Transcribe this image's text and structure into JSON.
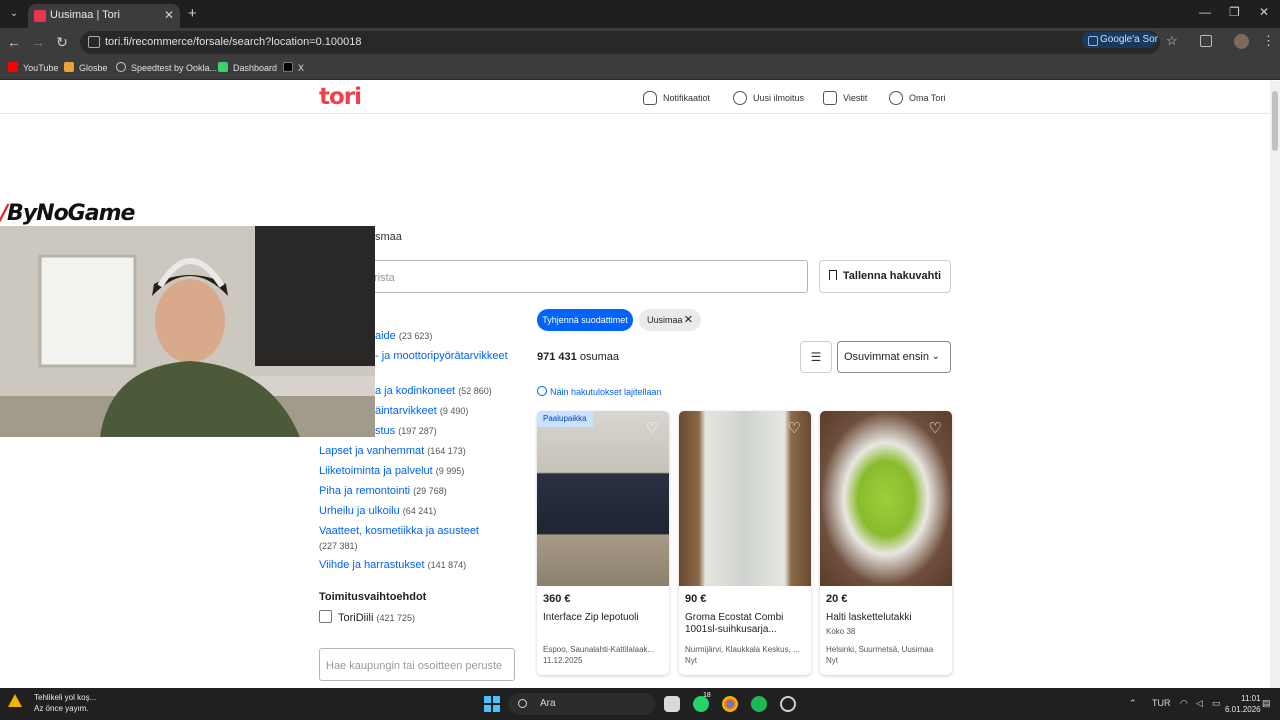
{
  "browser": {
    "tab_title": "Uusimaa | Tori",
    "url": "tori.fi/recommerce/forsale/search?location=0.100018",
    "google_button": "Google'a Sor",
    "bookmarks": [
      "YouTube",
      "Glosbe",
      "Speedtest by Ookla...",
      "Dashboard",
      "X"
    ]
  },
  "header": {
    "logo": "tori",
    "nav": [
      "Notifikaatiot",
      "Uusi ilmoitus",
      "Viestit",
      "Oma Tori"
    ]
  },
  "overlay": {
    "brand": "ByNoGame"
  },
  "search": {
    "region_label": "smaa",
    "placeholder": "rista",
    "save_button": "Tallenna hakuvahti"
  },
  "filters": {
    "clear_chip": "Tyhjennä suodattimet",
    "region_chip": "Uusimaa"
  },
  "categories": [
    {
      "label": "aide",
      "count": "(23 623)"
    },
    {
      "label": "- ja moottoripyörätarvikkeet",
      "count": ""
    },
    {
      "label": "a ja kodinkoneet",
      "count": "(52 860)"
    },
    {
      "label": "äintarvikkeet",
      "count": "(9 490)"
    },
    {
      "label": "stus",
      "count": "(197 287)"
    },
    {
      "label": "Lapset ja vanhemmat",
      "count": "(164 173)"
    },
    {
      "label": "Liiketoiminta ja palvelut",
      "count": "(9 995)"
    },
    {
      "label": "Piha ja remontointi",
      "count": "(29 768)"
    },
    {
      "label": "Urheilu ja ulkoilu",
      "count": "(64 241)"
    },
    {
      "label": "Vaatteet, kosmetiikka ja asusteet",
      "count": "(227 381)"
    },
    {
      "label": "Viihde ja harrastukset",
      "count": "(141 874)"
    }
  ],
  "results": {
    "count": "971 431",
    "count_suffix": "osumaa",
    "sort": "Osuvimmat ensin",
    "sort_info": "Näin hakutulokset lajitellaan"
  },
  "listings": [
    {
      "badge": "Paalupaikka",
      "price": "360 €",
      "title": "Interface Zip lepotuoli",
      "extra": "",
      "location": "Espoo, Saunalahti-Kattilalaak...",
      "date": "11.12.2025"
    },
    {
      "badge": "",
      "price": "90 €",
      "title": "Groma Ecostat Combi 1001sl-suihkusarja...",
      "extra": "",
      "location": "Nurmijärvi, Klaukkala Keskus, ...",
      "date": "Nyt"
    },
    {
      "badge": "",
      "price": "20 €",
      "title": "Halti laskettelutakki",
      "extra": "Koko 38",
      "location": "Helsinki, Suurmetsä, Uusimaa",
      "date": "Nyt"
    }
  ],
  "delivery": {
    "title": "Toimitusvaihtoehdot",
    "option_label": "ToriDiili",
    "option_count": "(421 725)",
    "address_placeholder": "Hae kaupungin tai osoitteen peruste"
  },
  "taskbar": {
    "notification_title": "Tehlikeli yol koş...",
    "notification_sub": "Az önce yayım.",
    "search_placeholder": "Ara",
    "language": "TUR",
    "time": "11:01",
    "date": "6.01.2026",
    "whatsapp_badge": "18"
  }
}
